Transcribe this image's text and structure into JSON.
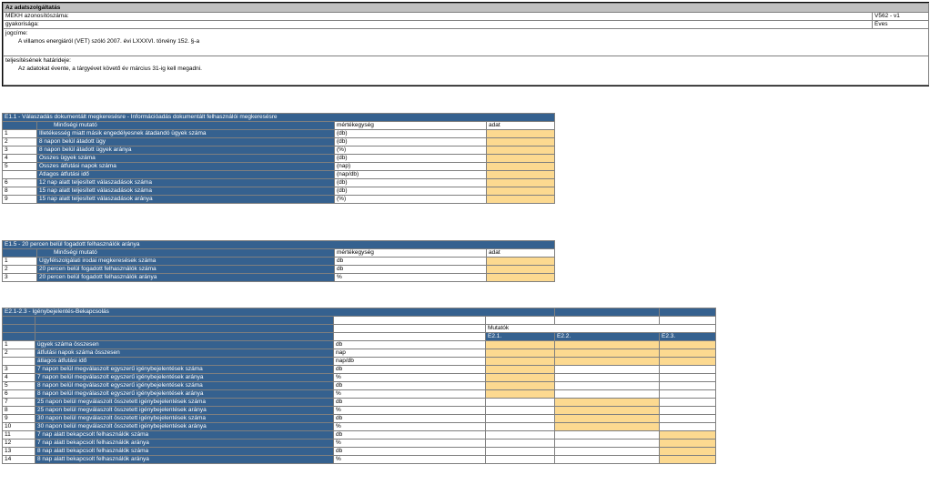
{
  "header": {
    "title": "Az adatszolgáltatás",
    "mekh_label": "MEKH azonosítószáma:",
    "mekh_value": "V562 - v1",
    "freq_label": "gyakorisága:",
    "freq_value": "Éves",
    "legal_label": "jogcíme:",
    "legal_text": "A villamos energiáról (VET) szóló 2007. évi LXXXVI. törvény 152. §-a",
    "deadline_label": "teljesítésének határideje:",
    "deadline_text": "Az adatokat évente, a tárgyévet követő év március 31-ig kell megadni."
  },
  "section1": {
    "title": "E1.1 - Válaszadás dokumentált megkeresésre - Információadás dokumentált felhasználói megkeresésre",
    "col_metric": "Minőségi mutató",
    "col_unit": "mértékegység",
    "col_value": "adat",
    "rows": [
      {
        "num": "1",
        "label": "Illetékesség miatt másik engedélyesnek átadandó ügyek száma",
        "unit": "(db)",
        "input": true
      },
      {
        "num": "2",
        "label": "8 napon belül átadott ügy",
        "unit": "(db)",
        "input": true
      },
      {
        "num": "3",
        "label": "8 napon belül átadott ügyek aránya",
        "unit": "(%)",
        "input": true
      },
      {
        "num": "4",
        "label": "Összes ügyek száma",
        "unit": "(db)",
        "input": true
      },
      {
        "num": "5",
        "label": "Összes átfutási napok száma",
        "unit": "(nap)",
        "input": true
      },
      {
        "num": "",
        "label": "Átlagos átfutási idő",
        "unit": "(nap/db)",
        "input": true
      },
      {
        "num": "6",
        "label": "12 nap alatt teljesített válaszadások száma",
        "unit": "(db)",
        "input": true
      },
      {
        "num": "8",
        "label": "15 nap alatt teljesített válaszadások száma",
        "unit": "(db)",
        "input": true
      },
      {
        "num": "9",
        "label": "15 nap alatt teljesített válaszadások  aránya",
        "unit": "(%)",
        "input": true
      }
    ]
  },
  "section2": {
    "title": "E1.5 - 20 percen belül fogadott felhasználók aránya",
    "col_metric": "Minőségi mutató",
    "col_unit": "mértékegység",
    "col_value": "adat",
    "rows": [
      {
        "num": "1",
        "label": "Ügyfélszolgálati irodai megkeresések száma",
        "unit": "db"
      },
      {
        "num": "2",
        "label": "20 percen belül fogadott felhasználók száma",
        "unit": "db"
      },
      {
        "num": "3",
        "label": "20 percen belül fogadott felhasználók aránya",
        "unit": "%"
      }
    ]
  },
  "section3": {
    "title": "E2.1-2.3 - Igénybejelentés-Bekapcsolás",
    "mutatok": "Mutatók",
    "cols": [
      "E2.1.",
      "E2.2.",
      "E2.3."
    ],
    "rows": [
      {
        "num": "1",
        "label": "ügyek száma összesen",
        "unit": "db",
        "fill": [
          1,
          1,
          1
        ]
      },
      {
        "num": "2",
        "label": "átfutási napok száma összesen",
        "unit": "nap",
        "fill": [
          1,
          1,
          1
        ]
      },
      {
        "num": "",
        "label": "átlagos átfutási idő",
        "unit": "nap/db",
        "fill": [
          1,
          1,
          1
        ]
      },
      {
        "num": "3",
        "label": "7 napon belül megválaszolt egyszerű igénybejelentések száma",
        "unit": "db",
        "fill": [
          1,
          0,
          0
        ]
      },
      {
        "num": "4",
        "label": "7 napon belül megválaszolt egyszerű igénybejelentések aránya",
        "unit": "%",
        "fill": [
          1,
          0,
          0
        ]
      },
      {
        "num": "5",
        "label": "8 napon belül megválaszolt egyszerű igénybejelentések száma",
        "unit": "db",
        "fill": [
          1,
          0,
          0
        ]
      },
      {
        "num": "6",
        "label": "8 napon belül megválaszolt egyszerű igénybejelentések aránya",
        "unit": "%",
        "fill": [
          1,
          0,
          0
        ]
      },
      {
        "num": "7",
        "label": "25 napon belül megválaszolt összetett igénybejelentések száma",
        "unit": "db",
        "fill": [
          0,
          1,
          0
        ]
      },
      {
        "num": "8",
        "label": "25 napon belül megválaszolt összetett igénybejelentések aránya",
        "unit": "%",
        "fill": [
          0,
          1,
          0
        ]
      },
      {
        "num": "9",
        "label": "30 napon belül megválaszolt összetett igénybejelentések száma",
        "unit": "db",
        "fill": [
          0,
          1,
          0
        ]
      },
      {
        "num": "10",
        "label": "30 napon belül megválaszolt összetett igénybejelentések aránya",
        "unit": "%",
        "fill": [
          0,
          1,
          0
        ]
      },
      {
        "num": "11",
        "label": "7 nap alatt bekapcsolt felhasználók száma",
        "unit": "db",
        "fill": [
          0,
          0,
          1
        ]
      },
      {
        "num": "12",
        "label": "7 nap alatt bekapcsolt felhasználók aránya",
        "unit": "%",
        "fill": [
          0,
          0,
          1
        ]
      },
      {
        "num": "13",
        "label": "8 nap alatt bekapcsolt felhasználók száma",
        "unit": "db",
        "fill": [
          0,
          0,
          1
        ]
      },
      {
        "num": "14",
        "label": "8 nap alatt bekapcsolt felhasználók aránya",
        "unit": "%",
        "fill": [
          0,
          0,
          1
        ]
      }
    ]
  },
  "colors": {
    "header_blue": "#35618f",
    "input_yellow": "#fcd990",
    "title_grey": "#c0c0c0"
  }
}
